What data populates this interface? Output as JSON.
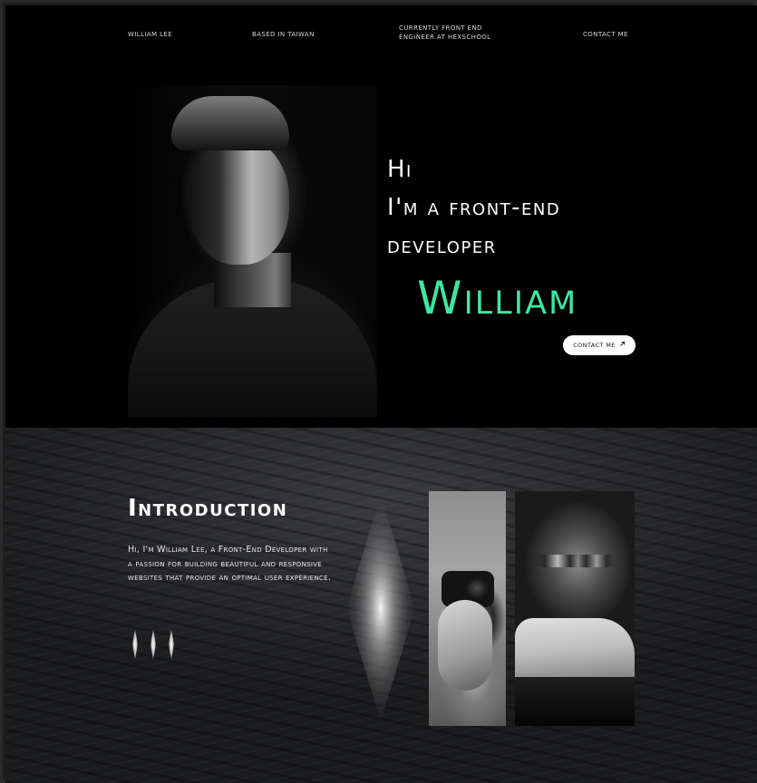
{
  "nav": {
    "name": "William Lee",
    "location": "Based in Taiwan",
    "current_line1": "Currently Front End",
    "current_line2": "Engineer at Hexschool",
    "contact": "Contact me"
  },
  "hero": {
    "line1": "Hi",
    "line2": "I'm a front-end",
    "line3": "developer",
    "name": "William",
    "contact_button": "Contact me",
    "contact_icon": "arrow-up-right-icon",
    "accent_color": "#3de8a2"
  },
  "intro": {
    "title": "Introduction",
    "text": "Hi, I'm William Lee, a Front-End Developer with a passion for building beautiful and responsive websites that provide an optimal user experience."
  }
}
